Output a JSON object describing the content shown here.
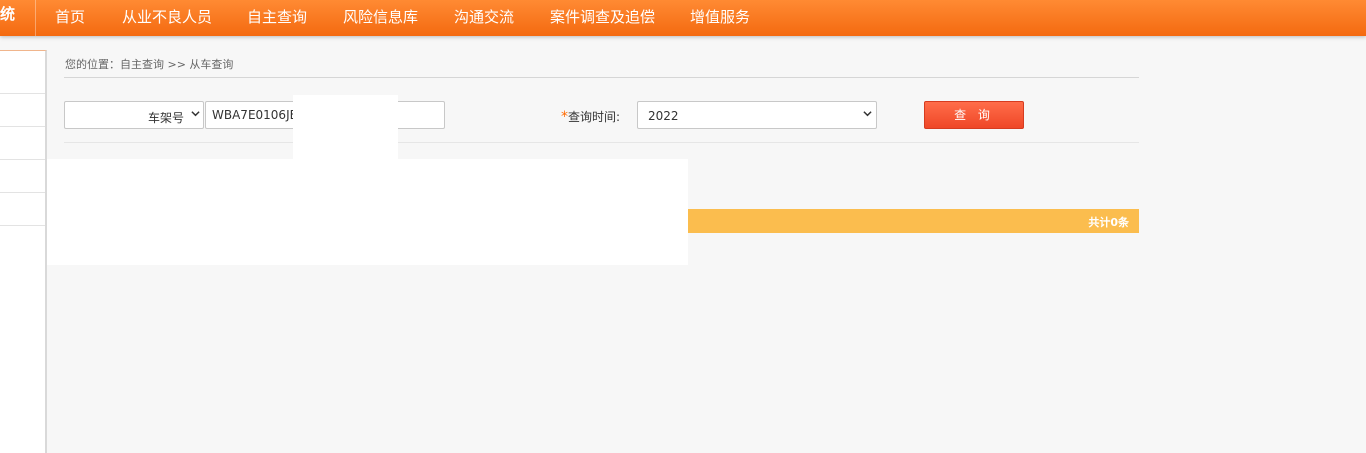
{
  "nav": {
    "brand_tail": "统",
    "items": [
      "首页",
      "从业不良人员",
      "自主查询",
      "风险信息库",
      "沟通交流",
      "案件调查及追偿",
      "增值服务"
    ]
  },
  "breadcrumb": "您的位置：自主查询 >> 从车查询",
  "form": {
    "type_select": "车架号",
    "vin_value": "WBA7E0106JB",
    "time_label": "查询时间:",
    "time_required_mark": "*",
    "time_select": "2022",
    "query_button": "查 询"
  },
  "result": {
    "count_label": "共计0条"
  },
  "colors": {
    "nav_bg": "#f46a10",
    "button": "#ef4727",
    "result_bar": "#fbbd4e"
  }
}
